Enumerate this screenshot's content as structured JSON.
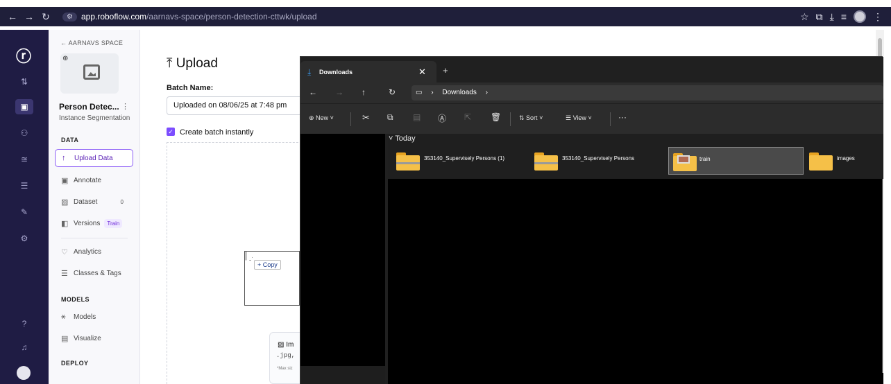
{
  "browser": {
    "url_host": "app.roboflow.com",
    "url_path": "/aarnavs-space/person-detection-cttwk/upload"
  },
  "sidebar": {
    "back_label": "← AARNAVS SPACE",
    "project_name": "Person Detec...",
    "project_type": "Instance Segmentation",
    "section_data": "DATA",
    "section_models": "MODELS",
    "section_deploy": "DEPLOY",
    "items": [
      {
        "label": "Upload Data",
        "icon": "↑"
      },
      {
        "label": "Annotate",
        "icon": "▣"
      },
      {
        "label": "Dataset",
        "icon": "▨",
        "badge": "0"
      },
      {
        "label": "Versions",
        "icon": "◧",
        "pill": "Train"
      },
      {
        "label": "Analytics",
        "icon": "♡"
      },
      {
        "label": "Classes & Tags",
        "icon": "☰"
      },
      {
        "label": "Models",
        "icon": "⚹"
      },
      {
        "label": "Visualize",
        "icon": "▤"
      }
    ]
  },
  "upload": {
    "title": "Upload",
    "batch_label": "Batch Name:",
    "batch_value": "Uploaded on 08/06/25 at 7:48 pm",
    "create_batch_label": "Create batch instantly",
    "copy_chip": "+ Copy",
    "format_title": "Im",
    "format_ext": ".jpg,",
    "format_max": "*Max siz"
  },
  "explorer": {
    "tab_title": "Downloads",
    "breadcrumb": "Downloads",
    "cmd_new": "New",
    "cmd_sort": "Sort",
    "cmd_view": "View",
    "group_label": "Today",
    "files": [
      {
        "name": "353140_Supervisely Persons (1)",
        "type": "zip"
      },
      {
        "name": "353140_Supervisely Persons",
        "type": "zip"
      },
      {
        "name": "train",
        "type": "photo-folder",
        "selected": true
      },
      {
        "name": "images",
        "type": "folder"
      }
    ]
  },
  "colors": {
    "accent": "#7c4dff",
    "rail_bg": "#1f1c44",
    "folder": "#f5c048"
  }
}
